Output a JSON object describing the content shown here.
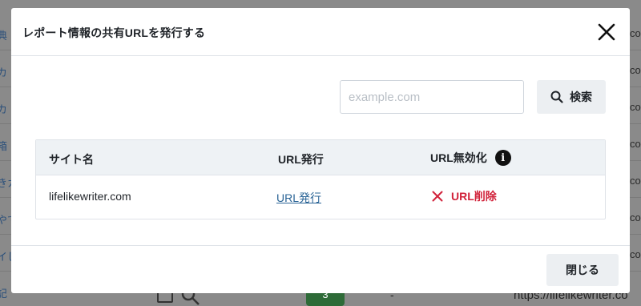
{
  "background": {
    "left_fragments": [
      "典",
      "カ",
      "カ",
      "箱",
      "きカ",
      "やて",
      "イし",
      "記"
    ],
    "right_fragments": [
      "co",
      "co",
      "co",
      "co",
      "co",
      "co",
      "co"
    ],
    "bottom": {
      "badge": "3",
      "dash": "-",
      "url": "https://lifelikewriter.co"
    }
  },
  "modal": {
    "title": "レポート情報の共有URLを発行する",
    "search": {
      "placeholder": "example.com",
      "button_label": "検索"
    },
    "table": {
      "headers": {
        "site": "サイト名",
        "issue": "URL発行",
        "revoke": "URL無効化"
      },
      "rows": [
        {
          "site": "lifelikewriter.com",
          "issue_link": "URL発行",
          "delete_label": "URL削除"
        }
      ]
    },
    "footer": {
      "close_label": "閉じる"
    }
  },
  "colors": {
    "overlay": "#8a8a8a",
    "delete": "#d1223a",
    "link": "#2a6496",
    "header_bg": "#eef2f5",
    "button_bg": "#eceff2"
  }
}
